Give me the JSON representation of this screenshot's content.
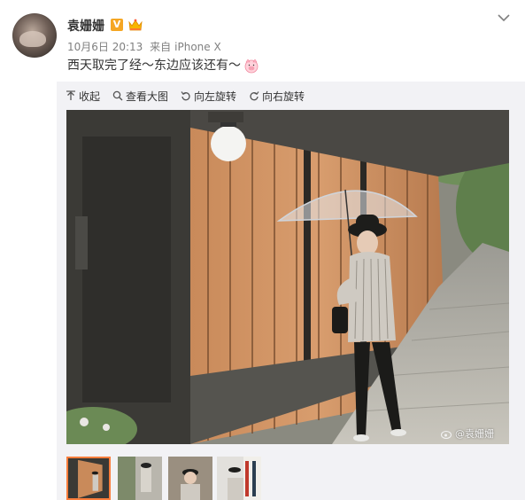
{
  "post": {
    "username": "袁姗姗",
    "verified_badge": "V",
    "date": "10月6日 20:13",
    "source_prefix": "来自",
    "source": "iPhone X",
    "text": "西天取完了经～东边应该还有～",
    "emoji": "pig-face-emoji"
  },
  "toolbar": {
    "collapse_label": "收起",
    "view_large_label": "查看大图",
    "rotate_left_label": "向左旋转",
    "rotate_right_label": "向右旋转"
  },
  "photo": {
    "watermark": "@袁姗姗"
  },
  "thumbnails": [
    {
      "name": "thumb-1",
      "active": true
    },
    {
      "name": "thumb-2",
      "active": false
    },
    {
      "name": "thumb-3",
      "active": false
    },
    {
      "name": "thumb-4",
      "active": false
    }
  ],
  "colors": {
    "accent": "#fa7d3c",
    "text": "#333333",
    "meta": "#808080",
    "media_bg": "#f2f2f5",
    "verified": "#f5a623"
  }
}
